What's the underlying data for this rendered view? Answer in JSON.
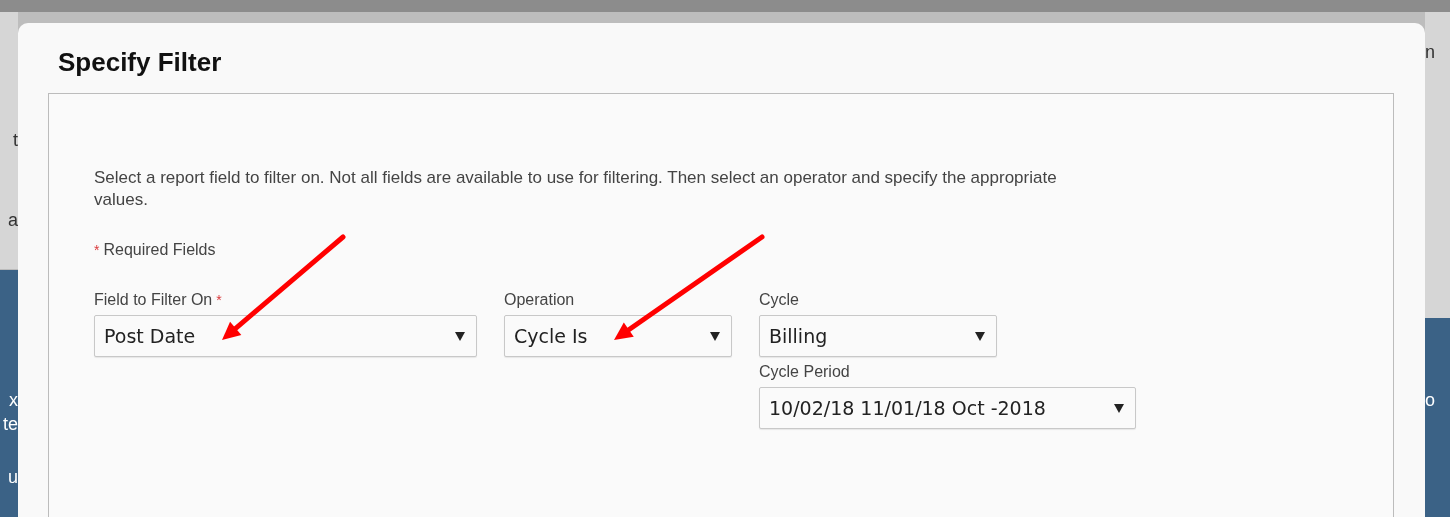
{
  "background": {
    "left_fragments": [
      "t",
      "a",
      "x",
      "te",
      "u"
    ],
    "right_fragments": [
      "n",
      "o"
    ]
  },
  "dialog": {
    "title": "Specify Filter",
    "description": "Select a report field to filter on. Not all fields are available to use for filtering. Then select an operator and specify the appropriate values.",
    "required_note": {
      "marker": "*",
      "text": "Required Fields"
    },
    "fields": [
      {
        "label": "Field to Filter On",
        "required": true,
        "value": "Post Date"
      },
      {
        "label": "Operation",
        "required": false,
        "value": "Cycle Is"
      },
      {
        "label": "Cycle",
        "required": false,
        "value": "Billing"
      },
      {
        "label": "Cycle Period",
        "required": false,
        "value": "10/02/18 11/01/18 Oct -2018"
      }
    ]
  }
}
